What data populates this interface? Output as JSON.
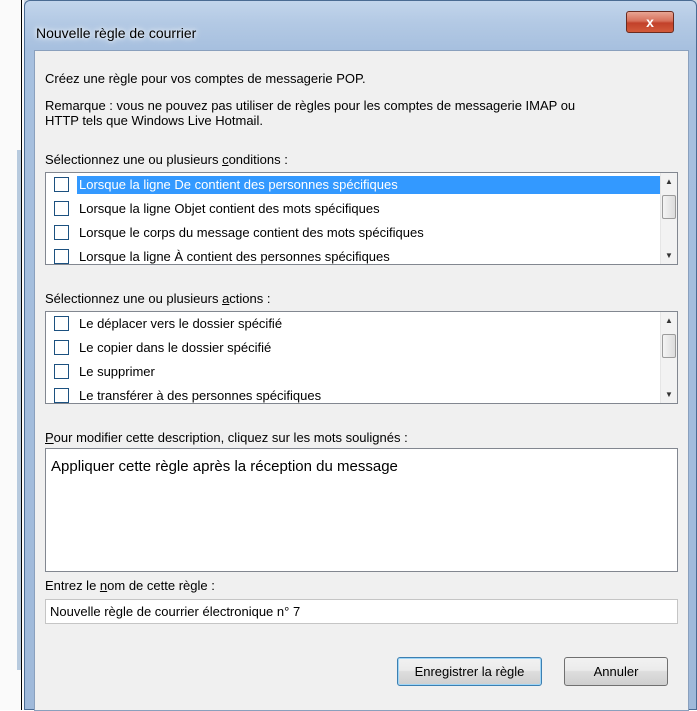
{
  "dialog": {
    "title": "Nouvelle règle de courrier",
    "close_glyph": "x",
    "intro": "Créez une règle pour vos comptes de messagerie POP.",
    "remark_line1": "Remarque : vous ne pouvez pas utiliser de règles pour les comptes de messagerie IMAP ou",
    "remark_line2": "HTTP tels que Windows Live Hotmail."
  },
  "conditions": {
    "label_before": "Sélectionnez une ou plusieurs ",
    "label_accel": "c",
    "label_after": "onditions :",
    "items": [
      {
        "label": "Lorsque la ligne De contient des personnes spécifiques",
        "checked": false,
        "selected": true
      },
      {
        "label": "Lorsque la ligne Objet contient des mots spécifiques",
        "checked": false,
        "selected": false
      },
      {
        "label": "Lorsque le corps du message contient des mots spécifiques",
        "checked": false,
        "selected": false
      },
      {
        "label": "Lorsque la ligne À contient des personnes spécifiques",
        "checked": false,
        "selected": false
      }
    ]
  },
  "actions": {
    "label_before": "Sélectionnez une ou plusieurs ",
    "label_accel": "a",
    "label_after": "ctions :",
    "items": [
      {
        "label": "Le déplacer vers le dossier spécifié",
        "checked": false
      },
      {
        "label": "Le copier dans le dossier spécifié",
        "checked": false
      },
      {
        "label": "Le supprimer",
        "checked": false
      },
      {
        "label": "Le transférer à des personnes spécifiques",
        "checked": false
      }
    ]
  },
  "description": {
    "label_accel": "P",
    "label_rest": "our modifier cette description, cliquez sur les mots soulignés :",
    "text": "Appliquer cette règle après la réception du message"
  },
  "rule_name": {
    "label_before": "Entrez le ",
    "label_accel": "n",
    "label_after": "om de cette règle :",
    "value": "Nouvelle règle de courrier électronique n° 7"
  },
  "buttons": {
    "save": "Enregistrer la règle",
    "cancel": "Annuler"
  },
  "scroll_glyphs": {
    "up": "▲",
    "down": "▼"
  },
  "colors": {
    "selection": "#3399ff",
    "title_gradient": "#b3c9e4",
    "close_button": "#c2412a"
  }
}
